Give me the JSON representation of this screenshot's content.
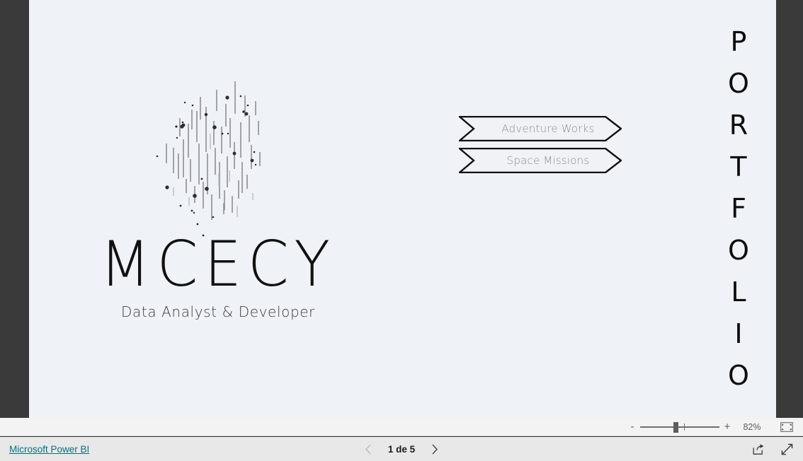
{
  "report": {
    "canvas_background": "#eff2f7",
    "letterbox_color": "#3a3a3a",
    "logo": {
      "wordmark": "MCECY",
      "tagline": "Data Analyst & Developer"
    },
    "side_title": {
      "text": "PORTFOLIO",
      "letters": [
        "P",
        "O",
        "R",
        "T",
        "F",
        "O",
        "L",
        "I",
        "O"
      ]
    },
    "nav_buttons": [
      {
        "label": "Adventure Works"
      },
      {
        "label": "Space Missions"
      }
    ]
  },
  "zoom_toolbar": {
    "minus_label": "-",
    "plus_label": "+",
    "zoom_value": "82%",
    "slider_position_percent": 45,
    "fit_icon": "fit-to-page-icon"
  },
  "status_bar": {
    "brand_link": "Microsoft Power BI",
    "page_indicator": "1 de 5",
    "prev_icon": "chevron-left-icon",
    "next_icon": "chevron-right-icon",
    "share_icon": "share-icon",
    "fullscreen_icon": "fullscreen-icon"
  }
}
